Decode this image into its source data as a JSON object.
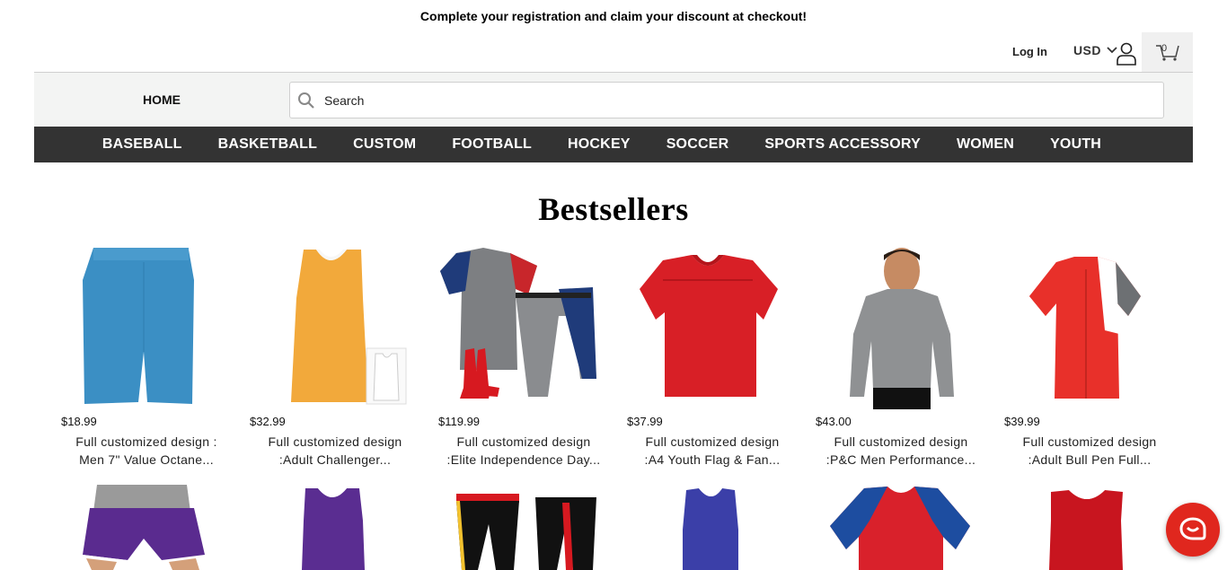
{
  "promo": {
    "text": "Complete your registration and claim your discount at checkout!"
  },
  "utility": {
    "login_label": "Log In",
    "currency_label": "USD",
    "cart_count": "0",
    "icons": {
      "user": "user-icon",
      "cart": "cart-icon",
      "currency_dropdown": "chevron-down-icon"
    }
  },
  "search": {
    "home_label": "HOME",
    "placeholder": "Search",
    "value": ""
  },
  "nav": {
    "items": [
      "BASEBALL",
      "BASKETBALL",
      "CUSTOM",
      "FOOTBALL",
      "HOCKEY",
      "SOCCER",
      "SPORTS ACCESSORY",
      "WOMEN",
      "YOUTH"
    ]
  },
  "section": {
    "title": "Bestsellers"
  },
  "products": [
    {
      "price": "$18.99",
      "line1": "Full customized design :",
      "line2": "Men 7\" Value Octane..."
    },
    {
      "price": "$32.99",
      "line1": "Full customized design",
      "line2": ":Adult Challenger..."
    },
    {
      "price": "$119.99",
      "line1": "Full customized design",
      "line2": ":Elite Independence Day..."
    },
    {
      "price": "$37.99",
      "line1": "Full customized design",
      "line2": ":A4 Youth Flag & Fan..."
    },
    {
      "price": "$43.00",
      "line1": "Full customized design",
      "line2": ":P&C Men Performance..."
    },
    {
      "price": "$39.99",
      "line1": "Full customized design",
      "line2": ":Adult Bull Pen Full..."
    }
  ],
  "colors": {
    "nav_bg": "#333333",
    "search_bg": "#f3f4f3",
    "chat_bg": "#e0271e"
  }
}
